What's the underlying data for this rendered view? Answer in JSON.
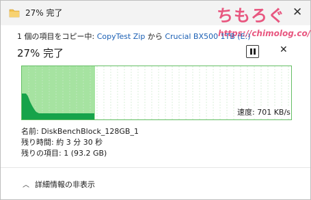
{
  "window": {
    "title": "27% 完了",
    "close_glyph": "✕"
  },
  "watermark": {
    "logo_text": "ちもろぐ",
    "url": "https://chimolog.co/"
  },
  "copy_info": {
    "prefix": "1 個の項目をコピー中: ",
    "source": "CopyTest Zip",
    "middle": " から ",
    "destination": "Crucial BX500 1TB (E:)"
  },
  "progress": {
    "heading": "27% 完了",
    "percent": 27
  },
  "controls": {
    "cancel_glyph": "✕"
  },
  "speed": {
    "label": "速度: 701 KB/s"
  },
  "details": {
    "name_label": "名前: ",
    "name_value": "DiskBenchBlock_128GB_1",
    "time_label": "残り時間: ",
    "time_value": "約 3 分 30 秒",
    "items_label": "残りの項目: ",
    "items_value": "1 (93.2 GB)"
  },
  "footer": {
    "chevron_glyph": "︿",
    "toggle_label": "詳細情報の非表示"
  },
  "colors": {
    "progress_fill": "#a6e3a1",
    "speed_fill": "#16a34a",
    "grid": "#c9e8c9",
    "link": "#1a5fb4",
    "watermark": "#e8567f"
  }
}
